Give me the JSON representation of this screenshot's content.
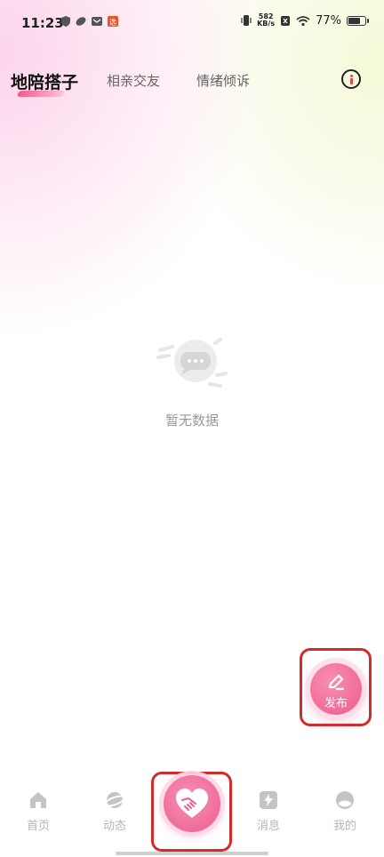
{
  "status_bar": {
    "time": "11:23",
    "net_speed_value": "582",
    "net_speed_unit": "KB/s",
    "battery": "77%",
    "battery_level": 0.77,
    "icons": [
      "shield-icon",
      "leaf-icon",
      "mail-icon",
      "app-badge-icon",
      "vibrate-icon",
      "sim-off-icon",
      "wifi-icon",
      "battery-icon"
    ]
  },
  "tabs": [
    {
      "label": "地陪搭子",
      "active": true
    },
    {
      "label": "相亲交友",
      "active": false
    },
    {
      "label": "情绪倾诉",
      "active": false
    }
  ],
  "empty_state": {
    "text": "暂无数据"
  },
  "publish_button": {
    "label": "发布"
  },
  "bottom_nav": [
    {
      "label": "首页",
      "icon": "home-icon"
    },
    {
      "label": "动态",
      "icon": "planet-icon"
    },
    {
      "label": "",
      "icon": "handshake-heart-icon"
    },
    {
      "label": "消息",
      "icon": "lightning-icon"
    },
    {
      "label": "我的",
      "icon": "profile-icon"
    }
  ],
  "colors": {
    "accent": "#ee5b8d",
    "highlight": "#d42a2a"
  }
}
